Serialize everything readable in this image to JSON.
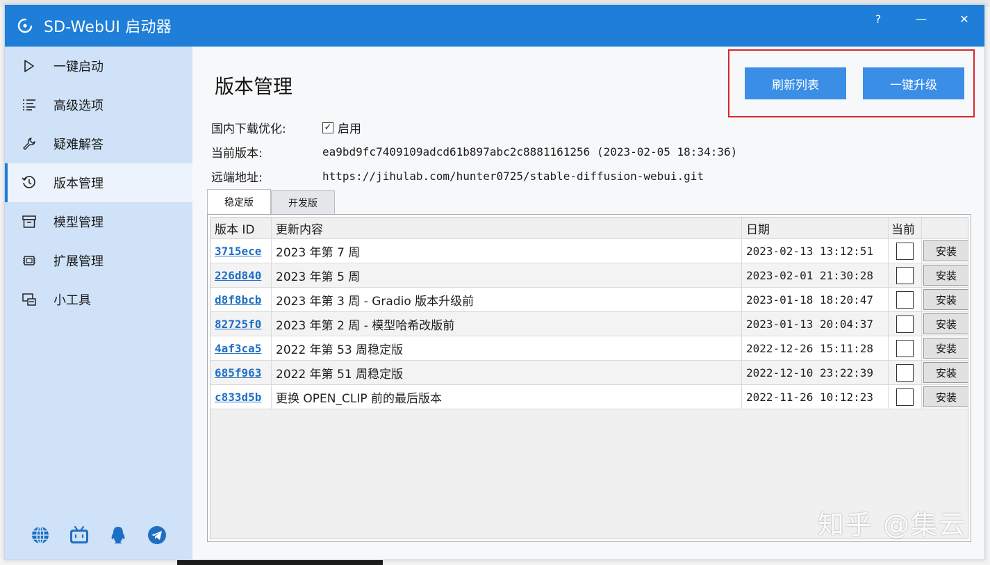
{
  "window": {
    "title": "SD-WebUI 启动器",
    "controls": {
      "help": "?",
      "minimize": "—",
      "close": "✕"
    }
  },
  "sidebar": {
    "items": [
      {
        "label": "一键启动",
        "icon": "play-icon"
      },
      {
        "label": "高级选项",
        "icon": "list-icon"
      },
      {
        "label": "疑难解答",
        "icon": "wrench-icon"
      },
      {
        "label": "版本管理",
        "icon": "history-icon",
        "active": true
      },
      {
        "label": "模型管理",
        "icon": "archive-icon"
      },
      {
        "label": "扩展管理",
        "icon": "chip-icon"
      },
      {
        "label": "小工具",
        "icon": "tools-icon"
      }
    ],
    "social_icons": [
      "globe-icon",
      "bilibili-icon",
      "qq-icon",
      "telegram-icon"
    ]
  },
  "main": {
    "title": "版本管理",
    "buttons": {
      "refresh": "刷新列表",
      "upgrade": "一键升级"
    },
    "mirror": {
      "label": "国内下载优化:",
      "checkbox_label": "启用",
      "checked": true
    },
    "current_version": {
      "label": "当前版本:",
      "value": "ea9bd9fc7409109adcd61b897abc2c8881161256 (2023-02-05 18:34:36)"
    },
    "remote": {
      "label": "远端地址:",
      "value": "https://jihulab.com/hunter0725/stable-diffusion-webui.git"
    },
    "tabs": [
      {
        "label": "稳定版",
        "active": true
      },
      {
        "label": "开发版",
        "active": false
      }
    ],
    "table": {
      "columns": [
        "版本 ID",
        "更新内容",
        "日期",
        "当前"
      ],
      "install_label": "安装",
      "rows": [
        {
          "id": "3715ece",
          "desc": "2023 年第 7 周",
          "date": "2023-02-13 13:12:51"
        },
        {
          "id": "226d840",
          "desc": "2023 年第 5 周",
          "date": "2023-02-01 21:30:28"
        },
        {
          "id": "d8f8bcb",
          "desc": "2023 年第 3 周 - Gradio 版本升级前",
          "date": "2023-01-18 18:20:47"
        },
        {
          "id": "82725f0",
          "desc": "2023 年第 2 周 - 模型哈希改版前",
          "date": "2023-01-13 20:04:37"
        },
        {
          "id": "4af3ca5",
          "desc": "2022 年第 53 周稳定版",
          "date": "2022-12-26 15:11:28"
        },
        {
          "id": "685f963",
          "desc": "2022 年第 51 周稳定版",
          "date": "2022-12-10 23:22:39"
        },
        {
          "id": "c833d5b",
          "desc": "更换 OPEN_CLIP 前的最后版本",
          "date": "2022-11-26 10:12:23"
        }
      ]
    }
  },
  "watermark": "知乎 @集云",
  "colors": {
    "accent": "#1e7ed8",
    "button": "#3a8ee6",
    "sidebar": "#cfe2f8",
    "highlight": "#d9262a",
    "link": "#1e6fc4"
  }
}
